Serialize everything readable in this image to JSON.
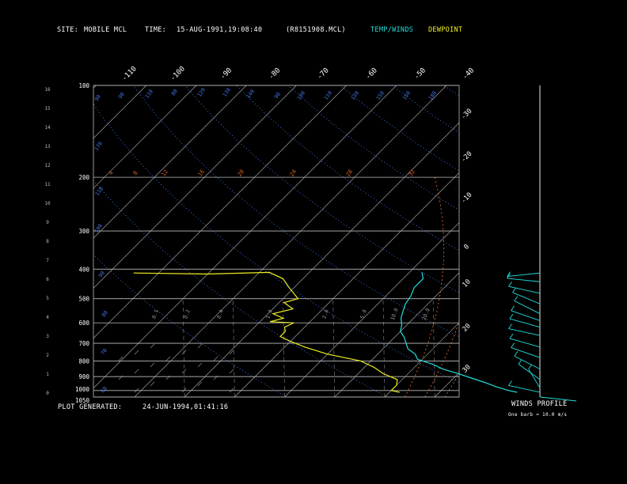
{
  "header": {
    "site_label": "SITE:",
    "site_value": "MOBILE MCL",
    "time_label": "TIME:",
    "time_value": "15-AUG-1991,19:08:40",
    "file": "(R8151908.MCL)",
    "legend_temp": "TEMP/WINDS",
    "legend_dew": "DEWPOINT"
  },
  "footer": {
    "generated_label": "PLOT GENERATED:",
    "generated_value": "24-JUN-1994,01:41:16",
    "winds_title": "WINDS PROFILE",
    "barb_note": "One barb = 10.0 m/s"
  },
  "colors": {
    "temp": "#22dddd",
    "dewpoint": "#eeee22",
    "grid": "#bbbbbb",
    "dry_adiabat": "#4477ee",
    "moist_adiabat": "#dd6622",
    "mixing_ratio": "#888888"
  },
  "chart_data": {
    "type": "line",
    "title": "",
    "skew_t": true,
    "pressure_levels_hpa": [
      "100",
      "200",
      "300",
      "400",
      "500",
      "600",
      "700",
      "800",
      "900",
      "1000",
      "1050"
    ],
    "height_ticks_km": [
      "0",
      "1",
      "2",
      "3",
      "4",
      "5",
      "6",
      "7",
      "8",
      "9",
      "10",
      "11",
      "12",
      "13",
      "14",
      "15",
      "16"
    ],
    "top_temp_labels": [
      "-110",
      "-100",
      "-90",
      "-80",
      "-70",
      "-60",
      "-50",
      "-40"
    ],
    "right_temp_labels": [
      "-30",
      "-20",
      "-10",
      "0",
      "10",
      "20",
      "30"
    ],
    "dry_adiabat_labels": [
      "90",
      "90",
      "110",
      "80",
      "120",
      "130",
      "140",
      "90",
      "100",
      "110",
      "130",
      "150",
      "160",
      "180",
      "170"
    ],
    "moist_adiabat_labels": [
      "4",
      "8",
      "12",
      "16",
      "20",
      "24",
      "28",
      "32"
    ],
    "mixing_ratio_labels": [
      "0.1",
      "0.2",
      "0.4",
      "1.0",
      "2.0",
      "5.0",
      "10.0",
      "20.0"
    ],
    "grid": true,
    "series": [
      {
        "name": "TEMP/WINDS",
        "points": [
          [
            -17.5,
            410
          ],
          [
            -16,
            430
          ],
          [
            -16,
            460
          ],
          [
            -15,
            490
          ],
          [
            -14.5,
            520
          ],
          [
            -13.5,
            550
          ],
          [
            -12.5,
            580
          ],
          [
            -11,
            610
          ],
          [
            -10,
            640
          ],
          [
            -8,
            670
          ],
          [
            -6.5,
            700
          ],
          [
            -5,
            730
          ],
          [
            -2.5,
            760
          ],
          [
            -1,
            790
          ],
          [
            3,
            820
          ],
          [
            6,
            850
          ],
          [
            10,
            880
          ],
          [
            13.5,
            910
          ],
          [
            17,
            940
          ],
          [
            20,
            970
          ],
          [
            23.5,
            1000
          ],
          [
            25.5,
            1013
          ]
        ]
      },
      {
        "name": "DEWPOINT",
        "points": [
          [
            -75,
            412
          ],
          [
            -60,
            415
          ],
          [
            -48,
            410
          ],
          [
            -44,
            430
          ],
          [
            -41,
            460
          ],
          [
            -37,
            500
          ],
          [
            -39,
            515
          ],
          [
            -36,
            540
          ],
          [
            -39,
            560
          ],
          [
            -36,
            580
          ],
          [
            -38,
            595
          ],
          [
            -33,
            600
          ],
          [
            -34,
            620
          ],
          [
            -33,
            640
          ],
          [
            -33,
            665
          ],
          [
            -30,
            690
          ],
          [
            -26,
            720
          ],
          [
            -20,
            760
          ],
          [
            -12,
            800
          ],
          [
            -8,
            840
          ],
          [
            -5,
            880
          ],
          [
            -1,
            920
          ],
          [
            0,
            960
          ],
          [
            0,
            1000
          ],
          [
            2,
            1013
          ]
        ]
      }
    ],
    "wind_profile": [
      {
        "pressure": 412,
        "dir": 280,
        "spd": 25
      },
      {
        "pressure": 440,
        "dir": 260,
        "spd": 20
      },
      {
        "pressure": 480,
        "dir": 250,
        "spd": 15
      },
      {
        "pressure": 520,
        "dir": 235,
        "spd": 18
      },
      {
        "pressure": 560,
        "dir": 230,
        "spd": 25
      },
      {
        "pressure": 590,
        "dir": 240,
        "spd": 22
      },
      {
        "pressure": 620,
        "dir": 245,
        "spd": 28
      },
      {
        "pressure": 660,
        "dir": 250,
        "spd": 30
      },
      {
        "pressure": 720,
        "dir": 245,
        "spd": 25
      },
      {
        "pressure": 780,
        "dir": 240,
        "spd": 20
      },
      {
        "pressure": 850,
        "dir": 230,
        "spd": 18
      },
      {
        "pressure": 920,
        "dir": 220,
        "spd": 15
      },
      {
        "pressure": 980,
        "dir": 200,
        "spd": 12
      },
      {
        "pressure": 1013,
        "dir": 250,
        "spd": 20
      }
    ]
  }
}
